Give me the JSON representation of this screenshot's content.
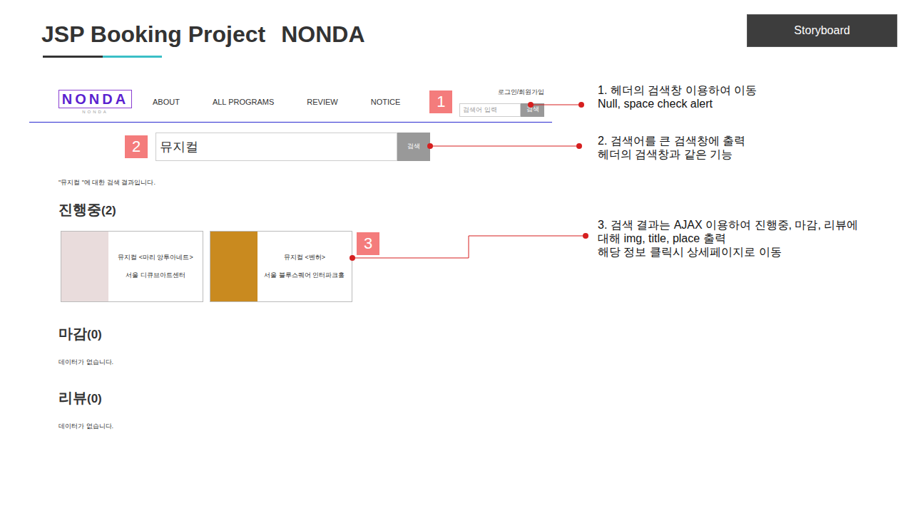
{
  "slide": {
    "title": "JSP Booking Project",
    "project": "NONDA",
    "button": "Storyboard"
  },
  "header": {
    "logo": "NONDA",
    "logo_sub": "NONDA",
    "nav": [
      "ABOUT",
      "ALL PROGRAMS",
      "REVIEW",
      "NOTICE"
    ],
    "auth": "로그인/회원가입",
    "search": {
      "placeholder": "검색어 입력",
      "button": "검색"
    }
  },
  "search_box": {
    "value": "뮤지컬",
    "button": "검색"
  },
  "result_caption": "\"뮤지컬 \"에 대한 검색 결과입니다.",
  "sections": [
    {
      "title": "진행중",
      "count": "(2)",
      "items": [
        {
          "title": "뮤지컬 <마리 앙투아네트>",
          "place": "서울 디큐브아트센터",
          "color": "#e9dcdc"
        },
        {
          "title": "뮤지컬 <벤허>",
          "place": "서울 블루스퀘어 인터파크홀",
          "color": "#c98a1f"
        }
      ]
    },
    {
      "title": "마감",
      "count": "(0)",
      "items": [],
      "empty": "데이터가 없습니다."
    },
    {
      "title": "리뷰",
      "count": "(0)",
      "items": [],
      "empty": "데이터가 없습니다."
    }
  ],
  "badges": [
    "1",
    "2",
    "3"
  ],
  "annotations": [
    {
      "lines": [
        "1. 헤더의 검색창 이용하여 이동",
        "Null, space check alert"
      ]
    },
    {
      "lines": [
        "2. 검색어를 큰 검색창에 출력",
        "헤더의 검색창과 같은 기능"
      ]
    },
    {
      "lines": [
        "3. 검색 결과는 AJAX 이용하여 진행중, 마감, 리뷰에",
        "대해 img, title, place 출력",
        "해당 정보 클릭시 상세페이지로 이동"
      ]
    }
  ]
}
